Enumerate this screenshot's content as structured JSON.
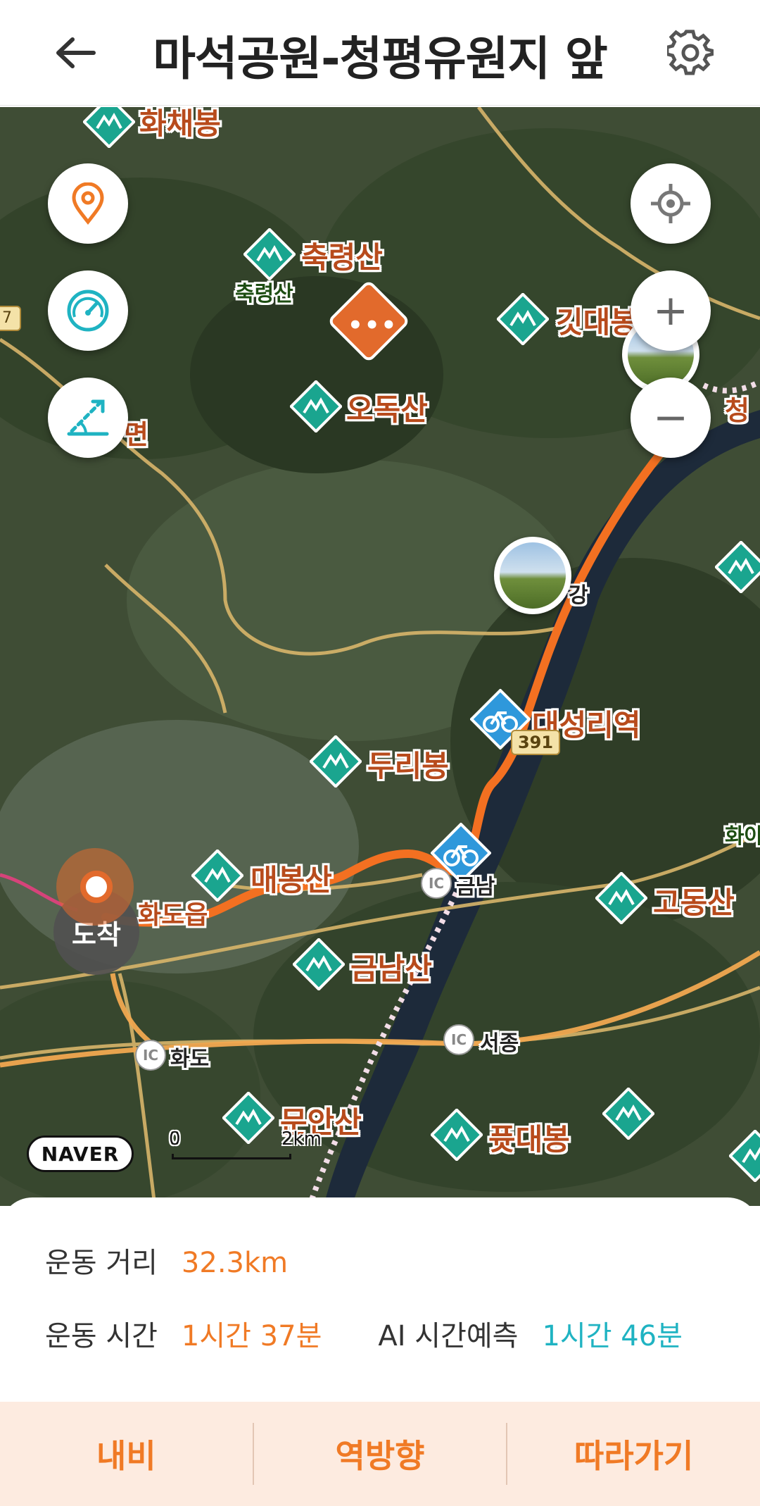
{
  "header": {
    "title": "마석공원-청평유원지 앞",
    "back_icon": "arrow-left-icon",
    "settings_icon": "gear-icon"
  },
  "map": {
    "labels": {
      "hwachaebong": "화채봉",
      "chungryeongsan": "축령산",
      "chungryeongsan_small": "축령산",
      "gitdaebong": "깃대봉",
      "odoksan": "오독산",
      "myeon": "면",
      "cheong": "청",
      "gang": "강",
      "daeseongri": "대성리역",
      "road_391": "391",
      "duribong": "두리봉",
      "maebongsan": "매봉산",
      "geumnam": "금남",
      "hwado_eup": "화도읍",
      "godongsan": "고동산",
      "geumnamsan": "금남산",
      "hwado": "화도",
      "seojong": "서종",
      "munansan": "문안산",
      "pyotdaebong": "퓻대봉",
      "hwa": "화아",
      "road_7": "7"
    },
    "ic_label": "IC",
    "arrival_label": "도착",
    "naver_logo": "NAVER",
    "scale_start": "0",
    "scale_end": "2km",
    "colors": {
      "route": "#f37021",
      "peak": "#1aa58f",
      "accent": "#f07a25",
      "ai": "#1fb3c2"
    }
  },
  "controls": {
    "location_pin_icon": "location-pin-icon",
    "speedometer_icon": "speedometer-icon",
    "elevation_icon": "elevation-icon",
    "gps_icon": "crosshair-icon",
    "zoom_in": "+",
    "zoom_out": "−"
  },
  "stats": {
    "distance_label": "운동 거리",
    "distance_value": "32.3km",
    "time_label": "운동 시간",
    "time_value": "1시간 37분",
    "ai_label": "AI 시간예측",
    "ai_value": "1시간 46분"
  },
  "actions": {
    "navi": "내비",
    "reverse": "역방향",
    "follow": "따라가기"
  }
}
